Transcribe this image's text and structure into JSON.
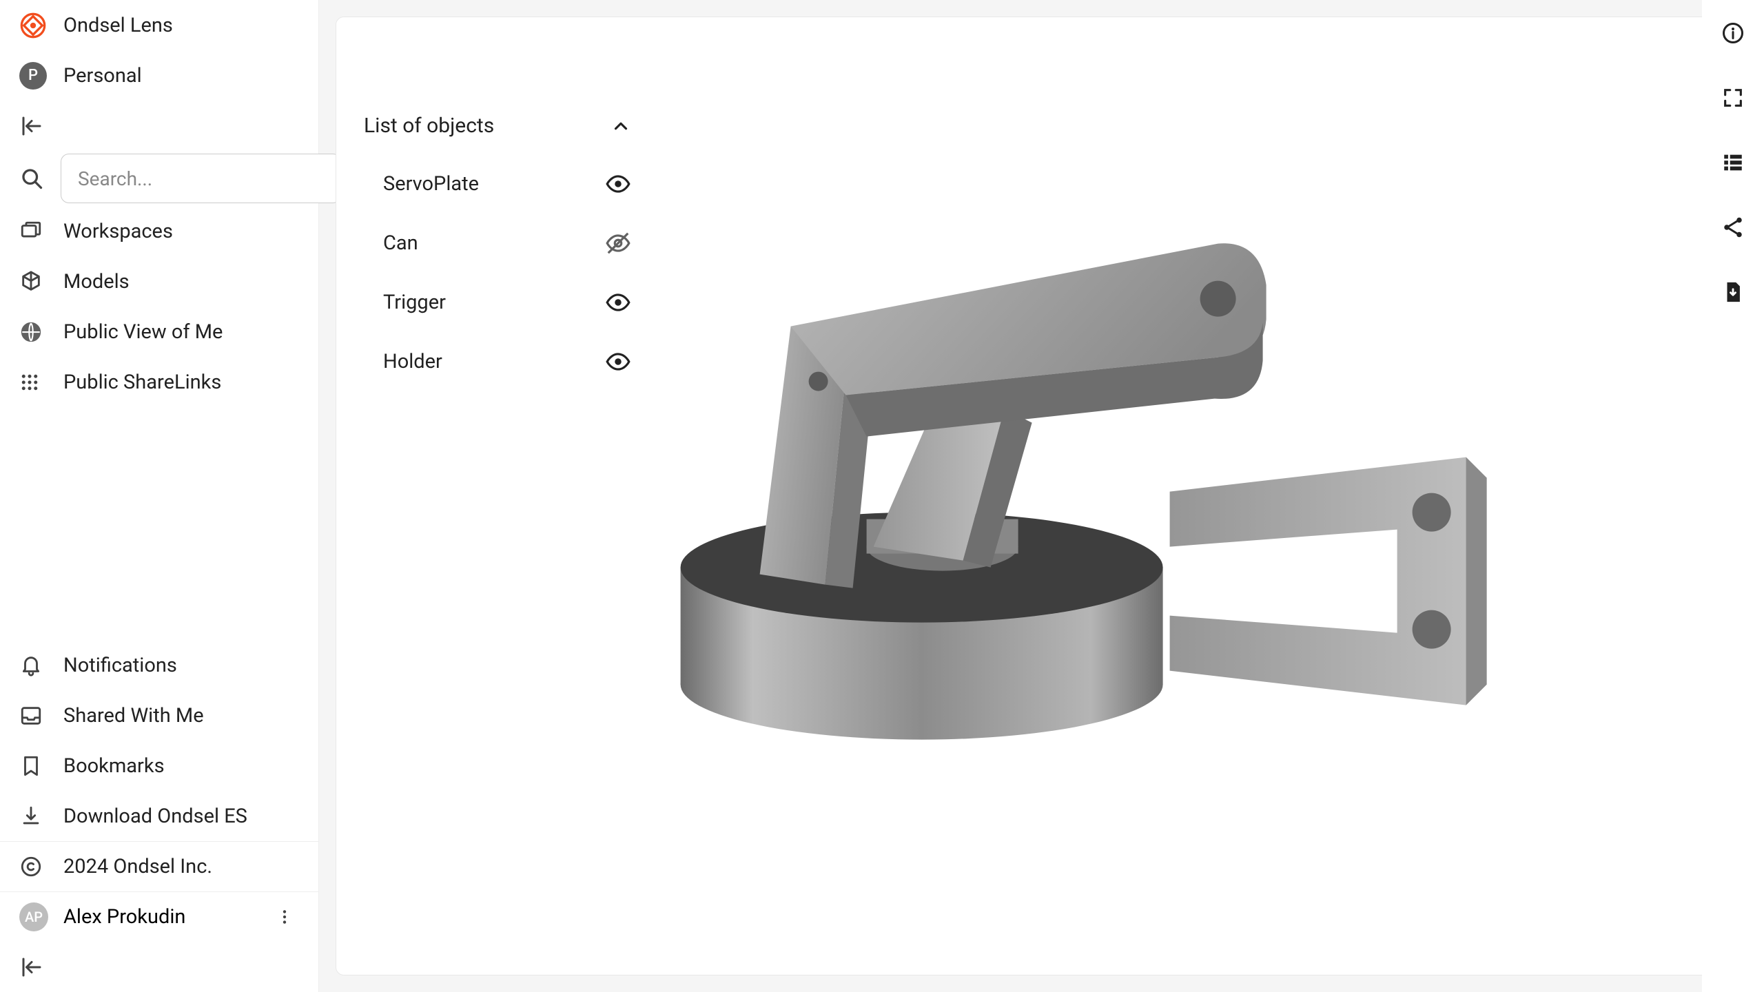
{
  "app": {
    "title": "Ondsel Lens"
  },
  "profile": {
    "label": "Personal",
    "initial": "P"
  },
  "search": {
    "placeholder": "Search..."
  },
  "nav": {
    "workspaces": "Workspaces",
    "models": "Models",
    "public_view": "Public View of Me",
    "sharelinks": "Public ShareLinks"
  },
  "footer": {
    "notifications": "Notifications",
    "shared": "Shared With Me",
    "bookmarks": "Bookmarks",
    "download": "Download Ondsel ES",
    "copyright": "2024 Ondsel Inc."
  },
  "user": {
    "name": "Alex Prokudin",
    "initials": "AP"
  },
  "objects": {
    "header": "List of objects",
    "items": [
      {
        "name": "ServoPlate",
        "visible": true
      },
      {
        "name": "Can",
        "visible": false
      },
      {
        "name": "Trigger",
        "visible": true
      },
      {
        "name": "Holder",
        "visible": true
      }
    ]
  }
}
